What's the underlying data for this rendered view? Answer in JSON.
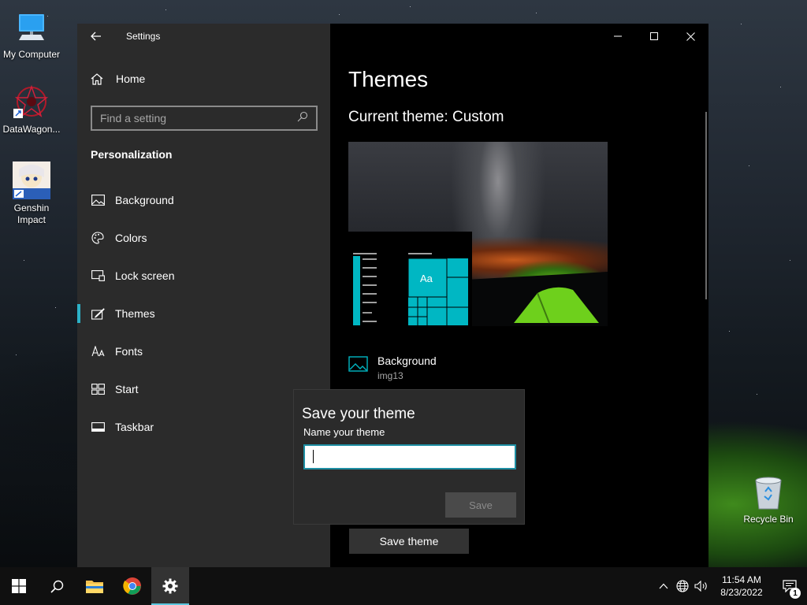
{
  "desktop": {
    "icons": [
      {
        "label": "My Computer"
      },
      {
        "label": "DataWagon..."
      },
      {
        "label": "Genshin Impact"
      }
    ],
    "recycle_bin": "Recycle Bin"
  },
  "window": {
    "title": "Settings",
    "sidebar": {
      "home": "Home",
      "search_placeholder": "Find a setting",
      "section": "Personalization",
      "items": [
        {
          "label": "Background",
          "icon": "picture-icon"
        },
        {
          "label": "Colors",
          "icon": "palette-icon"
        },
        {
          "label": "Lock screen",
          "icon": "lock-screen-icon"
        },
        {
          "label": "Themes",
          "icon": "brush-icon",
          "active": true
        },
        {
          "label": "Fonts",
          "icon": "fonts-icon"
        },
        {
          "label": "Start",
          "icon": "start-icon"
        },
        {
          "label": "Taskbar",
          "icon": "taskbar-icon"
        }
      ]
    },
    "content": {
      "heading": "Themes",
      "current_theme": "Current theme: Custom",
      "preview_tile": "Aa",
      "background_label": "Background",
      "background_value": "img13",
      "save_theme_button": "Save theme"
    }
  },
  "dialog": {
    "title": "Save your theme",
    "label": "Name your theme",
    "input_value": "",
    "save_button": "Save"
  },
  "taskbar": {
    "time": "11:54 AM",
    "date": "8/23/2022",
    "notification_count": "1"
  },
  "colors": {
    "accent": "#00b7c3",
    "sidebar_bg": "#2b2b2b",
    "content_bg": "#000000"
  }
}
